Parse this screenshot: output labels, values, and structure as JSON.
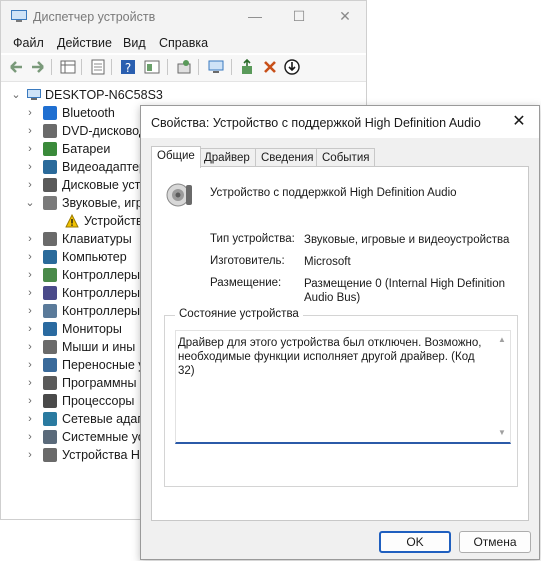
{
  "window": {
    "title": "Диспетчер устройств",
    "controls": {
      "minimize": "—",
      "maximize": "☐",
      "close": "✕"
    }
  },
  "menu": [
    "Файл",
    "Действие",
    "Вид",
    "Справка"
  ],
  "toolbar": {
    "icons": [
      "back-icon",
      "forward-icon",
      "properties-grid-icon",
      "doc-icon",
      "help-icon",
      "panel-icon",
      "scan-hardware-icon",
      "monitor-icon",
      "update-driver-icon",
      "uninstall-icon",
      "download-icon"
    ]
  },
  "tree": {
    "root": "DESKTOP-N6C58S3",
    "items": [
      {
        "label": "Bluetooth",
        "color": "#1f6fd1",
        "expanded": false
      },
      {
        "label": "DVD-дисковод",
        "color": "#6a6a6a",
        "expanded": false
      },
      {
        "label": "Батареи",
        "color": "#3a8a3a",
        "expanded": false
      },
      {
        "label": "Видеоадаптер",
        "color": "#2a6a9a",
        "expanded": false
      },
      {
        "label": "Дисковые устр",
        "color": "#5a5a5a",
        "expanded": false
      },
      {
        "label": "Звуковые, игр",
        "color": "#7a7a7a",
        "expanded": true
      },
      {
        "label": "Устройство",
        "color": "#e0a800",
        "expanded": false,
        "child": true,
        "warning": true
      },
      {
        "label": "Клавиатуры",
        "color": "#6a6a6a",
        "expanded": false
      },
      {
        "label": "Компьютер",
        "color": "#2a6a9a",
        "expanded": false
      },
      {
        "label": "Контроллеры",
        "color": "#4a8a4a",
        "expanded": false
      },
      {
        "label": "Контроллеры",
        "color": "#4a4a8a",
        "expanded": false
      },
      {
        "label": "Контроллеры",
        "color": "#5a7a9a",
        "expanded": false
      },
      {
        "label": "Мониторы",
        "color": "#2a6aa0",
        "expanded": false
      },
      {
        "label": "Мыши и ины",
        "color": "#6a6a6a",
        "expanded": false
      },
      {
        "label": "Переносные у",
        "color": "#3a6a9a",
        "expanded": false
      },
      {
        "label": "Программны",
        "color": "#5a5a5a",
        "expanded": false
      },
      {
        "label": "Процессоры",
        "color": "#4a4a4a",
        "expanded": false
      },
      {
        "label": "Сетевые адап",
        "color": "#2a7aa0",
        "expanded": false
      },
      {
        "label": "Системные ус",
        "color": "#5a6a7a",
        "expanded": false
      },
      {
        "label": "Устройства HI",
        "color": "#6a6a6a",
        "expanded": false
      }
    ]
  },
  "dialog": {
    "title": "Свойства: Устройство с поддержкой High Definition Audio",
    "close": "✕",
    "tabs": [
      "Общие",
      "Драйвер",
      "Сведения",
      "События"
    ],
    "device_name": "Устройство с поддержкой High Definition Audio",
    "properties": [
      {
        "label": "Тип устройства:",
        "value": "Звуковые, игровые и видеоустройства"
      },
      {
        "label": "Изготовитель:",
        "value": "Microsoft"
      },
      {
        "label": "Размещение:",
        "value": "Размещение 0 (Internal High Definition Audio Bus)"
      }
    ],
    "status_legend": "Состояние устройства",
    "status_text": "Драйвер для этого устройства был отключен. Возможно, необходимые функции исполняет другой драйвер. (Код 32)",
    "ok_label": "OK",
    "cancel_label": "Отмена"
  }
}
